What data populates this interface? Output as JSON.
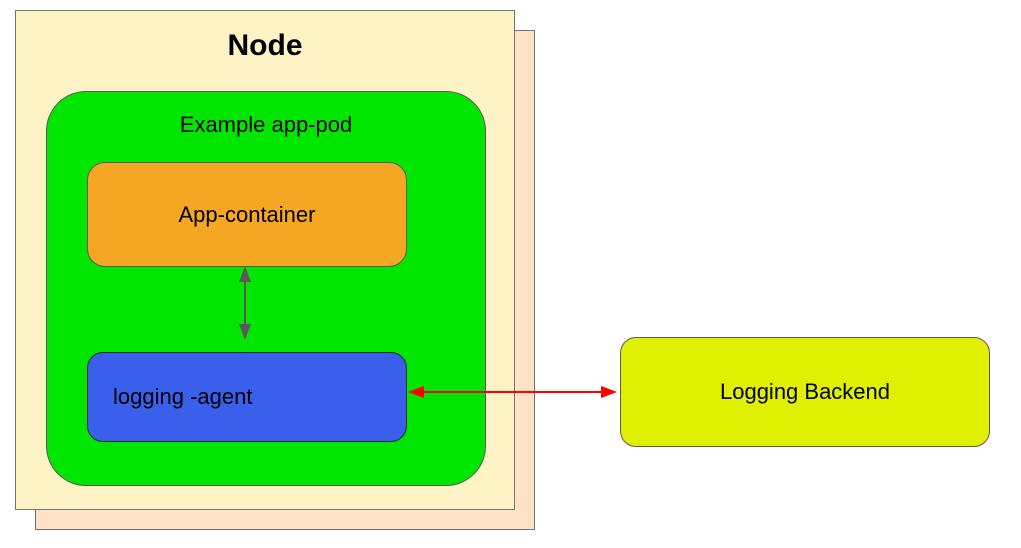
{
  "node": {
    "title": "Node"
  },
  "pod": {
    "title": "Example app-pod",
    "app_container_label": "App-container",
    "logging_agent_label": "logging -agent"
  },
  "backend": {
    "label": "Logging Backend"
  },
  "colors": {
    "node_bg": "#fdf3c4",
    "node_shadow": "#fde2c8",
    "pod_bg": "#00e600",
    "app_container_bg": "#f5a623",
    "logging_agent_bg": "#3a5fea",
    "backend_bg": "#e0f000",
    "arrow_vertical": "#595959",
    "arrow_horizontal": "#ff0000"
  }
}
